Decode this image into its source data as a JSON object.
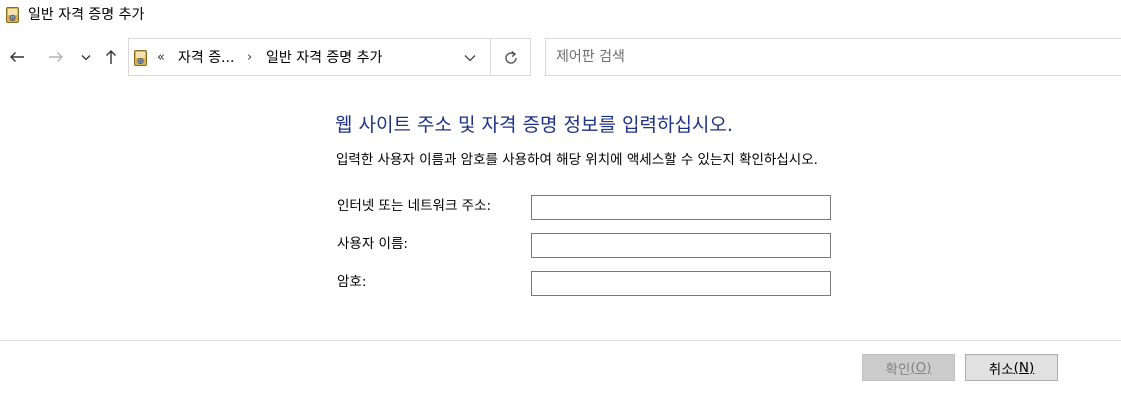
{
  "window": {
    "title": "일반 자격 증명 추가",
    "icon": "credential-manager-icon"
  },
  "nav": {
    "back_icon": "arrow-left-icon",
    "forward_icon": "arrow-right-icon",
    "recent_icon": "chevron-down-icon",
    "up_icon": "arrow-up-icon"
  },
  "address": {
    "overflow": "«",
    "crumbs": [
      "자격 증...",
      "일반 자격 증명 추가"
    ],
    "separator": "›",
    "dropdown_icon": "chevron-down-icon",
    "refresh_icon": "refresh-icon"
  },
  "search": {
    "placeholder": "제어판 검색",
    "value": ""
  },
  "content": {
    "heading": "웹 사이트 주소 및 자격 증명 정보를 입력하십시오.",
    "description": "입력한 사용자 이름과 암호를 사용하여 해당 위치에 액세스할 수 있는지 확인하십시오.",
    "fields": [
      {
        "label": "인터넷 또는 네트워크 주소:",
        "value": ""
      },
      {
        "label": "사용자 이름:",
        "value": ""
      },
      {
        "label": "암호:",
        "value": ""
      }
    ]
  },
  "buttons": {
    "ok": {
      "label": "확인",
      "mnemonic": "(O)",
      "enabled": false
    },
    "cancel": {
      "label": "취소",
      "mnemonic": "(N)",
      "enabled": true
    }
  },
  "colors": {
    "heading": "#1e3287",
    "ok_disabled_bg": "#cccccc",
    "cancel_bg": "#e1e1e1"
  }
}
